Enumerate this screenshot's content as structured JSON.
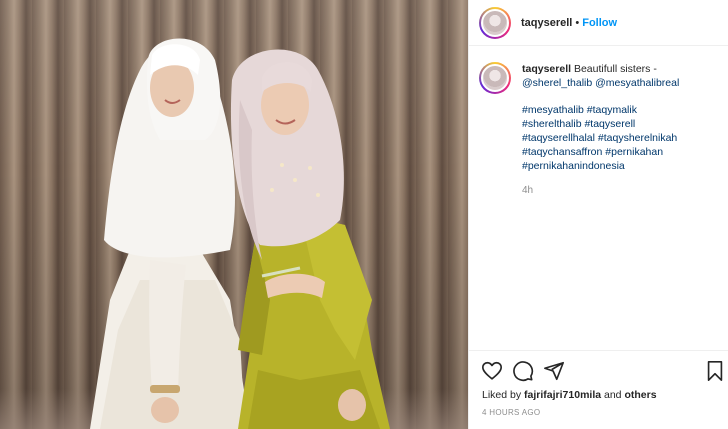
{
  "header": {
    "username": "taqyserell",
    "separator": "•",
    "follow_label": "Follow"
  },
  "caption": {
    "username": "taqyserell",
    "text": "Beautifull sisters -",
    "mentions": [
      "@sherel_thalib",
      "@mesyathalibreal"
    ],
    "hashtag_lines": [
      "#mesyathalib #taqymalik",
      "#sherelthalib #taqyserell",
      "#taqyserellhalal #taqysherelnikah",
      "#taqychansaffron #pernikahan",
      "#pernikahanindonesia"
    ],
    "age": "4h"
  },
  "actions": {
    "like_icon": "heart-icon",
    "comment_icon": "comment-icon",
    "share_icon": "share-icon",
    "save_icon": "bookmark-icon",
    "liked_prefix": "Liked by",
    "liked_user": "fajrifajri710mila",
    "liked_suffix": "and",
    "liked_others": "others",
    "timestamp": "4 HOURS AGO"
  },
  "colors": {
    "link": "#0095f6",
    "mention": "#00376b",
    "muted": "#8e8e8e"
  }
}
